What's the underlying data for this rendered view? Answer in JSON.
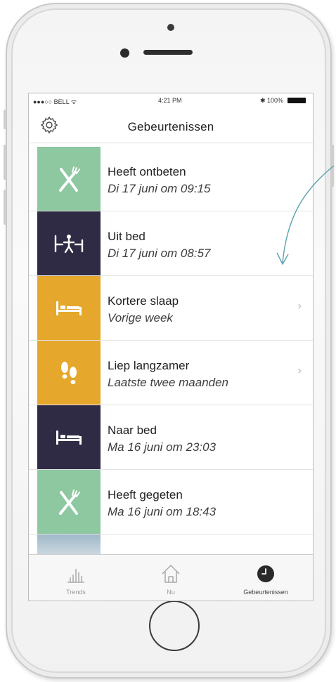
{
  "status_bar": {
    "carrier": "●●●○○ BELL ᯤ",
    "time": "4:21 PM",
    "battery": "✱ 100%"
  },
  "nav": {
    "title": "Gebeurtenissen",
    "settings_icon": "gear-icon"
  },
  "events": [
    {
      "title": "Heeft ontbeten",
      "subtitle": "Di 17 juni om 09:15",
      "icon": "fork-knife-icon",
      "color": "#8dc8a0",
      "chevron": false
    },
    {
      "title": "Uit bed",
      "subtitle": "Di 17 juni om 08:57",
      "icon": "out-of-bed-icon",
      "color": "#2f2b44",
      "chevron": false
    },
    {
      "title": "Kortere slaap",
      "subtitle": "Vorige week",
      "icon": "bed-icon",
      "color": "#e5a72c",
      "chevron": true
    },
    {
      "title": "Liep langzamer",
      "subtitle": "Laatste twee maanden",
      "icon": "footprints-icon",
      "color": "#e5a72c",
      "chevron": true
    },
    {
      "title": "Naar bed",
      "subtitle": "Ma 16 juni om 23:03",
      "icon": "bed-icon",
      "color": "#2f2b44",
      "chevron": false
    },
    {
      "title": "Heeft gegeten",
      "subtitle": "Ma 16 juni om 18:43",
      "icon": "fork-knife-icon",
      "color": "#8dc8a0",
      "chevron": false
    }
  ],
  "chevron_glyph": "›",
  "tabs": [
    {
      "label": "Trends",
      "icon": "bar-chart-icon",
      "active": false
    },
    {
      "label": "Nu",
      "icon": "home-icon",
      "active": false
    },
    {
      "label": "Gebeurtenissen",
      "icon": "clock-icon",
      "active": true
    }
  ],
  "colors": {
    "green": "#8dc8a0",
    "navy": "#2f2b44",
    "orange": "#e5a72c",
    "annotation": "#5ba3b0"
  }
}
